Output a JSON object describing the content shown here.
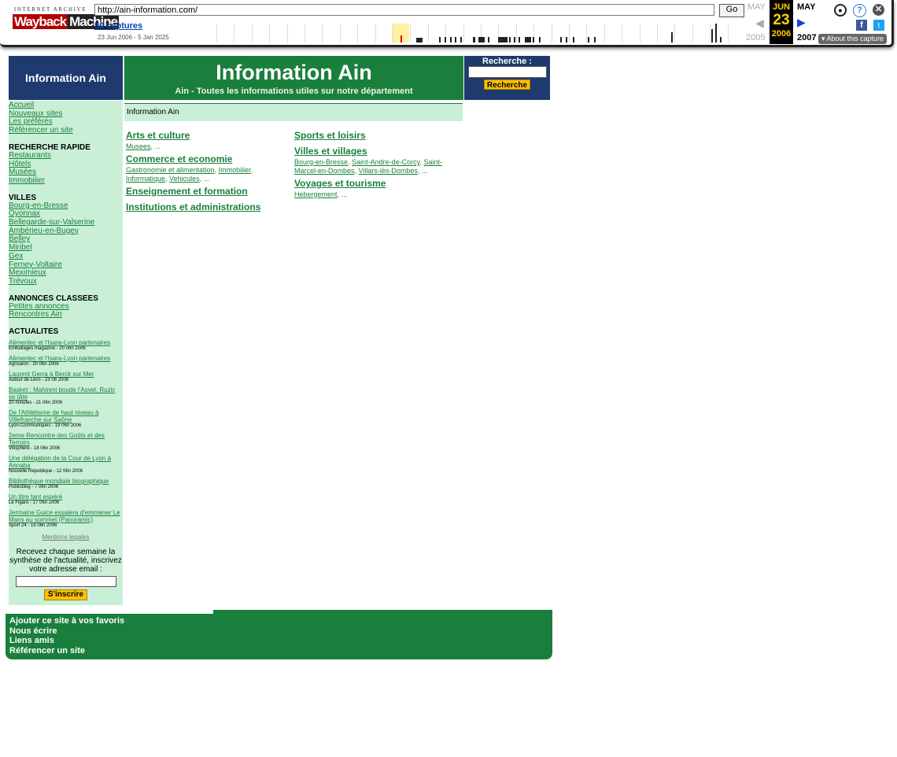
{
  "wayback": {
    "logo_top": "INTERNET ARCHIVE",
    "logo_w": "Wayback",
    "logo_m": "Machine",
    "url": "http://ain-information.com/",
    "go_label": "Go",
    "captures_label": "50 captures",
    "date_range": "23 Jun 2006 - 5 Jan 2025",
    "prev_month": "MAY",
    "prev_year": "2005",
    "cur_month": "JUN",
    "cur_day": "23",
    "cur_year": "2006",
    "next_month": "MAY",
    "next_year": "2007",
    "about_label": "▾ About this capture",
    "prev_arrow": "◀",
    "next_arrow": "▶",
    "icons": {
      "user": "user-icon",
      "help": "help-icon",
      "close": "close-icon",
      "facebook": "facebook-icon",
      "twitter": "twitter-icon"
    }
  },
  "header": {
    "left_title": "Information Ain",
    "site_title": "Information Ain",
    "tagline": "Ain - Toutes les informations utiles sur notre département",
    "search_label": "Recherche :",
    "search_button": "Recherche"
  },
  "sidebar": {
    "main_links": [
      "Accueil",
      "Nouveaux sites",
      "Les préférés",
      "Référencer un site"
    ],
    "quick_heading": "RECHERCHE RAPIDE",
    "quick_links": [
      "Restaurants",
      "Hôtels",
      "Musées",
      "Immobilier"
    ],
    "cities_heading": "VILLES",
    "cities": [
      "Bourg-en-Bresse",
      "Oyonnax",
      "Bellegarde-sur-Valserine",
      "Ambérieu-en-Bugey",
      "Belley",
      "Miribel",
      "Gex",
      "Ferney-Voltaire",
      "Meximieux",
      "Trévoux"
    ],
    "ads_heading": "ANNONCES CLASSEES",
    "ads_links": [
      "Petites annonces",
      "Rencontres Ain"
    ],
    "news_heading": "ACTUALITES",
    "news": [
      {
        "title": "Alimentec et l'Isara-Lyon partenaires",
        "source": "Emballages magazine - 20 06n 2006"
      },
      {
        "title": "Alimentec et l'Isara-Lyon partenaires",
        "source": "Agrisalon - 20 06n 2006"
      },
      {
        "title": "Laurent Gerra à Berck sur Mer",
        "source": "Autour de Lens - 23 06 2006"
      },
      {
        "title": "Basket : Mahinmi boude l'Asvel, Ruzic se tâte",
        "source": "20 minutes - 21 06n 2006"
      },
      {
        "title": "De l'Athlétisme de haut niveau à Villefranche sur Saône",
        "source": "Lyon-Communiques - 19 06n 2006"
      },
      {
        "title": "2eme Rencontre des Goûts et des Terroirs",
        "source": "Vitisphere - 18 06n 2006"
      },
      {
        "title": "Une délégation de la Cour de Lyon à Annaba",
        "source": "Nouvelle République - 12 06n 2006"
      },
      {
        "title": "Bibliothèque mondiale biographique",
        "source": "Publicblog - 7 06n 2006"
      },
      {
        "title": "Un titre tant espéré",
        "source": "Le Figaro - 17 06n 2006"
      },
      {
        "title": "Jermaine Guice essaiera d'emmener Le Mans au sommet (Panoramic)",
        "source": "Sport 24 - 15 06n 2006"
      }
    ],
    "legal": "Mentions legales",
    "newsletter_text": "Recevez chaque semaine la synthèse de l'actualité, inscrivez votre adresse email :",
    "subscribe_label": "S'inscrire"
  },
  "breadcrumb": "Information Ain",
  "categories_left": [
    {
      "title": "Arts et culture",
      "subs": [
        "Musees",
        "..."
      ]
    },
    {
      "title": "Commerce et economie",
      "subs": [
        "Gastronomie et alimentation",
        "Immobilier",
        "Informatique",
        "Vehicules",
        "..."
      ]
    },
    {
      "title": "Enseignement et formation",
      "subs": []
    },
    {
      "title": "Institutions et administrations",
      "subs": []
    }
  ],
  "categories_right": [
    {
      "title": "Sports et loisirs",
      "subs": []
    },
    {
      "title": "Villes et villages",
      "subs": [
        "Bourg-en-Bresse",
        "Saint-Andre-de-Corcy",
        "Saint-Marcel-en-Dombes",
        "Villars-lès-Dombes",
        "..."
      ]
    },
    {
      "title": "Voyages et tourisme",
      "subs": [
        "Hebergement",
        "..."
      ]
    }
  ],
  "footer": {
    "links": [
      "Ajouter ce site à vos favoris",
      "Nous écrire",
      "Liens amis",
      "Référencer un site"
    ]
  },
  "colors": {
    "green": "#1a7f3c",
    "navy": "#1e3a6e",
    "light_green": "#c9f0d7",
    "yellow": "#ffc107"
  }
}
